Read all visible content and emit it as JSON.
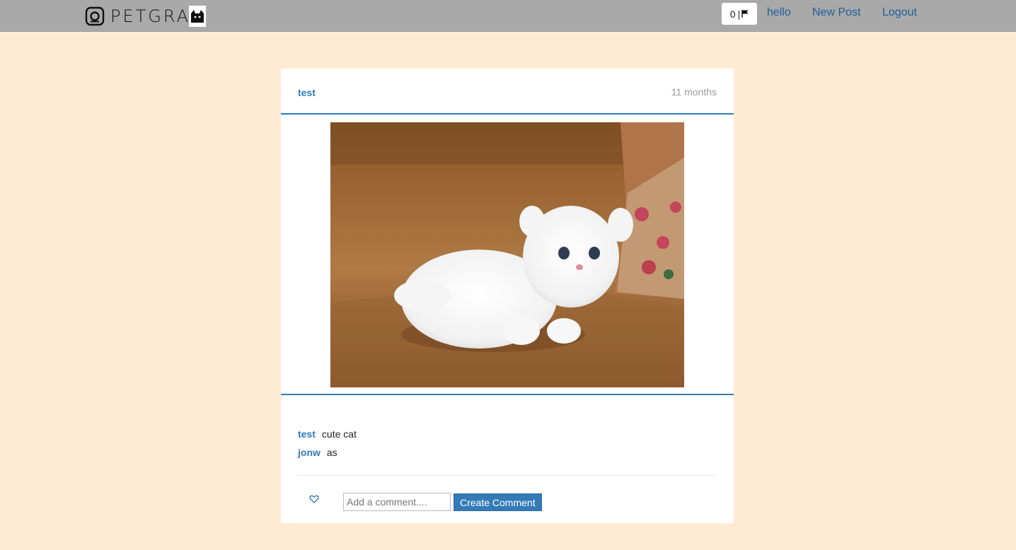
{
  "navbar": {
    "brand_text": "PETGRA",
    "notification_count": "0",
    "links": {
      "hello": "hello",
      "new_post": "New Post",
      "logout": "Logout"
    }
  },
  "post": {
    "author": "test",
    "time_ago": "11 months",
    "image_alt": "white kitten sitting on a brown couch"
  },
  "comments": [
    {
      "user": "test",
      "text": "cute cat"
    },
    {
      "user": "jonw",
      "text": "as"
    }
  ],
  "comment_form": {
    "placeholder": "Add a comment....",
    "value": "",
    "submit_label": "Create Comment"
  },
  "colors": {
    "background": "#ffebd4",
    "navbar": "#a9a9a9",
    "accent": "#337ab7",
    "link": "#1d5f9a"
  },
  "icons": [
    "instagram-icon",
    "cat-icon",
    "flag-icon",
    "heart-icon"
  ]
}
